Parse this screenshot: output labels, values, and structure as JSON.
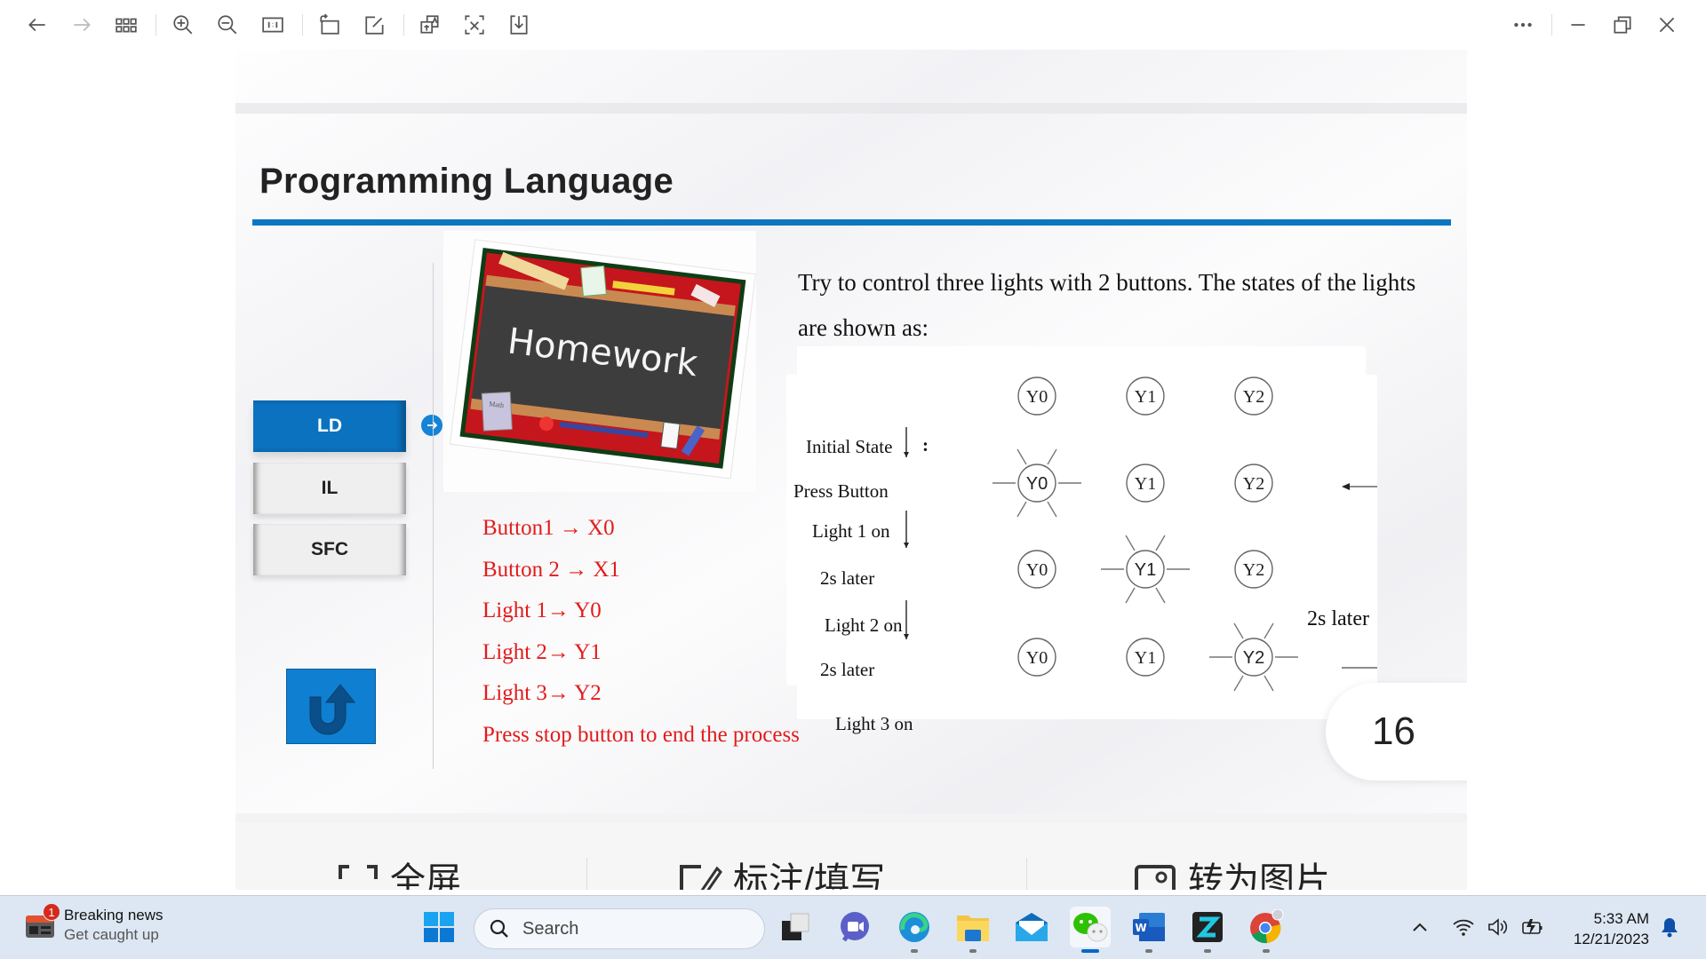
{
  "toolbar": {
    "buttons": [
      {
        "name": "back",
        "icon": "arrow-left-icon",
        "enabled": true
      },
      {
        "name": "forward",
        "icon": "arrow-right-icon",
        "enabled": false
      },
      {
        "name": "thumbnails",
        "icon": "grid-icon",
        "enabled": true
      },
      {
        "name": "zoom-in",
        "icon": "zoom-in-icon",
        "enabled": true
      },
      {
        "name": "zoom-out",
        "icon": "zoom-out-icon",
        "enabled": true
      },
      {
        "name": "actual-size",
        "icon": "one-to-one-icon",
        "enabled": true
      },
      {
        "name": "rotate",
        "icon": "rotate-icon",
        "enabled": true
      },
      {
        "name": "edit",
        "icon": "edit-icon",
        "enabled": true
      },
      {
        "name": "translate",
        "icon": "translate-icon",
        "enabled": true
      },
      {
        "name": "extract-text",
        "icon": "ocr-icon",
        "enabled": true
      },
      {
        "name": "download",
        "icon": "download-icon",
        "enabled": true
      }
    ],
    "more_icon": "more-icon",
    "window_controls": [
      "minimize-icon",
      "restore-icon",
      "close-icon"
    ]
  },
  "slide": {
    "title": "Programming Language",
    "accent_color": "#0e76c1",
    "nav": [
      {
        "label": "LD",
        "active": true
      },
      {
        "label": "IL",
        "active": false
      },
      {
        "label": "SFC",
        "active": false
      }
    ],
    "image_caption": "Homework",
    "image_book_label": "Math",
    "mappings": [
      "Button1 → X0",
      "Button 2 → X1",
      "Light 1→ Y0",
      "Light 2→ Y1",
      "Light 3→ Y2",
      "Press stop button to end the process"
    ],
    "mapping_color": "#e31b1b",
    "description": "Try to control three lights with 2 buttons. The states of the lights are shown as:",
    "diagram": {
      "initial_label": "Initial State",
      "colon": ":",
      "press_label": "Press Button",
      "states": [
        {
          "label": "Light 1 on",
          "lit": "Y0"
        },
        {
          "label": "Light 2 on",
          "lit": "Y1"
        },
        {
          "label": "Light 3 on",
          "lit": "Y2"
        }
      ],
      "transition_label": "2s later",
      "loop_label": "2s later",
      "lights": [
        "Y0",
        "Y1",
        "Y2"
      ]
    },
    "page_number": "16"
  },
  "actions": [
    {
      "label": "全屏",
      "icon": "fullscreen-icon"
    },
    {
      "label": "标注/填写",
      "icon": "annotate-icon"
    },
    {
      "label": "转为图片",
      "icon": "convert-image-icon"
    }
  ],
  "taskbar": {
    "news_title": "Breaking news",
    "news_subtitle": "Get caught up",
    "news_badge": "1",
    "search_placeholder": "Search",
    "apps": [
      {
        "name": "task-view",
        "running": false
      },
      {
        "name": "teams-meet",
        "running": false
      },
      {
        "name": "edge",
        "running": true
      },
      {
        "name": "file-explorer",
        "running": true
      },
      {
        "name": "mail",
        "running": false
      },
      {
        "name": "wechat",
        "running": true,
        "active": true
      },
      {
        "name": "word",
        "running": true
      },
      {
        "name": "zoom-z-app",
        "running": true
      },
      {
        "name": "chrome",
        "running": true
      }
    ],
    "time": "5:33 AM",
    "date": "12/21/2023"
  }
}
